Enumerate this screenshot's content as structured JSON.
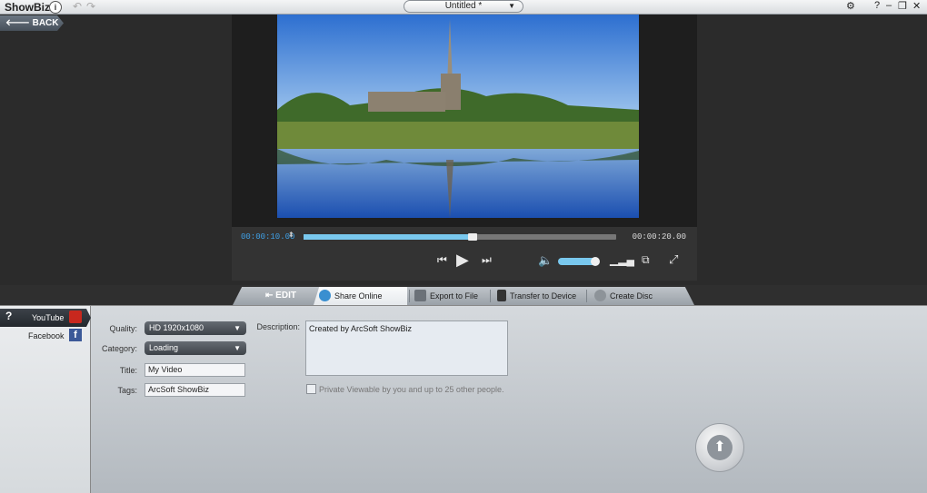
{
  "app": {
    "name": "ShowBiz",
    "info_icon": "i",
    "undo_icon": "↶",
    "redo_icon": "↷"
  },
  "project": {
    "title": "Untitled *"
  },
  "window_controls": {
    "settings": "⚙",
    "help": "?",
    "minimize": "–",
    "restore": "❐",
    "close": "✕"
  },
  "back": {
    "label": "BACK"
  },
  "player": {
    "current_time": "00:00:10.00",
    "total_time": "00:00:20.00",
    "progress": 0.54,
    "volume": 0.85
  },
  "tabs": [
    {
      "label": "EDIT"
    },
    {
      "label": "Share Online"
    },
    {
      "label": "Export to File"
    },
    {
      "label": "Transfer to Device"
    },
    {
      "label": "Create Disc"
    }
  ],
  "sidebar": {
    "help": "?",
    "items": [
      {
        "label": "YouTube"
      },
      {
        "label": "Facebook"
      }
    ],
    "fb_glyph": "f"
  },
  "form": {
    "quality_label": "Quality:",
    "quality_value": "HD 1920x1080",
    "category_label": "Category:",
    "category_value": "Loading",
    "title_label": "Title:",
    "title_value": "My Video",
    "tags_label": "Tags:",
    "tags_value": "ArcSoft ShowBiz",
    "description_label": "Description:",
    "description_value": "Created by ArcSoft ShowBiz",
    "private_label": "Private Viewable by you and up to 25 other people."
  },
  "colors": {
    "accent": "#79c8ee",
    "time_accent": "#3fa0e6"
  }
}
